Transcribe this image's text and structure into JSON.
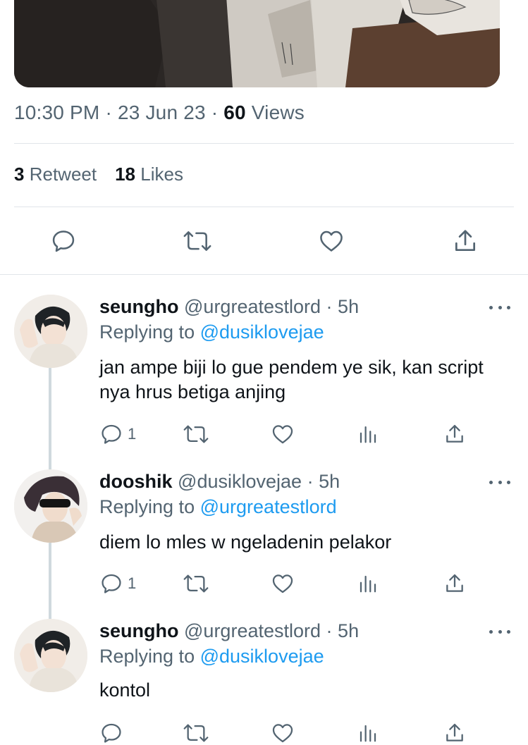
{
  "tweet": {
    "time": "10:30 PM",
    "date": "23 Jun 23",
    "views_count": "60",
    "views_label": "Views",
    "retweets_count": "3",
    "retweets_label": "Retweet",
    "likes_count": "18",
    "likes_label": "Likes"
  },
  "separator": "·",
  "replying_prefix": "Replying to",
  "replies": [
    {
      "name": "seungho",
      "handle": "@urgreatestlord",
      "time": "5h",
      "replying_to": "@dusiklovejae",
      "text": "jan ampe biji lo gue pendem ye sik, kan script nya hrus betiga anjing",
      "reply_count": "1"
    },
    {
      "name": "dooshik",
      "handle": "@dusiklovejae",
      "time": "5h",
      "replying_to": "@urgreatestlord",
      "text": "diem lo mles w ngeladenin pelakor",
      "reply_count": "1"
    },
    {
      "name": "seungho",
      "handle": "@urgreatestlord",
      "time": "5h",
      "replying_to": "@dusiklovejae",
      "text": "kontol",
      "reply_count": ""
    }
  ],
  "colors": {
    "text_primary": "#0f1419",
    "text_secondary": "#536471",
    "link": "#1d9bf0",
    "divider": "#e1e5e9",
    "thread_line": "#cfd9de"
  },
  "icons": [
    "reply-icon",
    "retweet-icon",
    "like-icon",
    "share-icon",
    "views-icon",
    "more-icon"
  ]
}
